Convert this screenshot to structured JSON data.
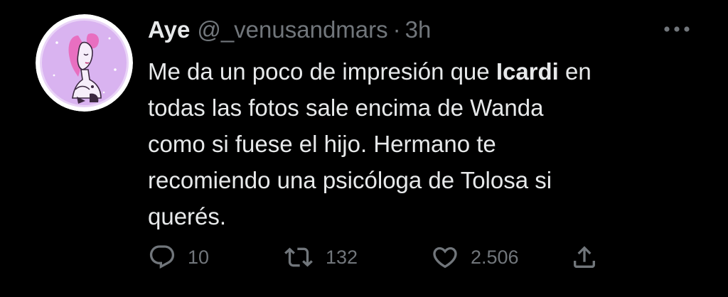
{
  "author": {
    "name": "Aye",
    "handle": "@_venusandmars",
    "separator": "·",
    "time": "3h"
  },
  "tweet": {
    "line1_a": "Me da un poco de impresión que ",
    "line1_bold": "Icardi",
    "line1_b": " en",
    "line2": "todas las fotos sale encima de Wanda",
    "line3": "como si fuese el hijo. Hermano te",
    "line4": "recomiendo una psicóloga de Tolosa si",
    "line5": "querés."
  },
  "actions": {
    "replies": "10",
    "retweets": "132",
    "likes": "2.506"
  },
  "icons": {
    "more": "more-dots-icon",
    "reply": "reply-bubble-icon",
    "retweet": "retweet-icon",
    "like": "heart-icon",
    "share": "share-icon"
  },
  "colors": {
    "background": "#000000",
    "text": "#e7e9ea",
    "secondary": "#71767b",
    "avatar_bg": "#d9b3f0"
  }
}
